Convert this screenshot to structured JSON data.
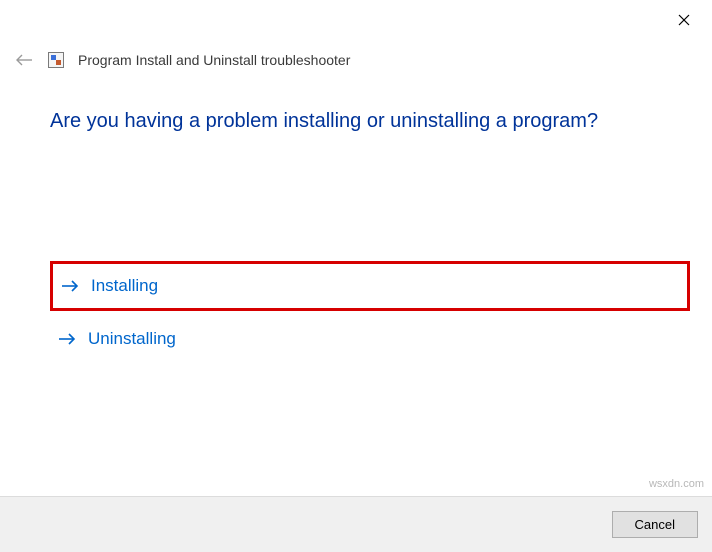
{
  "window": {
    "title": "Program Install and Uninstall troubleshooter"
  },
  "content": {
    "question": "Are you having a problem installing or uninstalling a program?",
    "options": [
      {
        "label": "Installing",
        "highlighted": true
      },
      {
        "label": "Uninstalling",
        "highlighted": false
      }
    ]
  },
  "footer": {
    "cancel_label": "Cancel"
  },
  "watermark": "wsxdn.com"
}
